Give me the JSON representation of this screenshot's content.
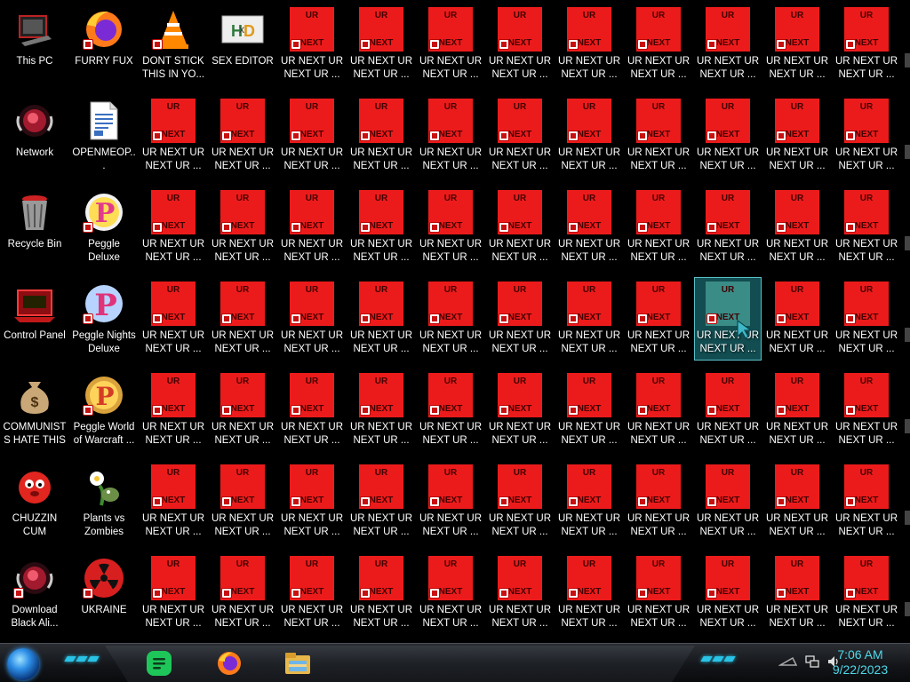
{
  "desktop": {
    "left_icons": [
      {
        "label": "This PC",
        "icon": "computer-icon"
      },
      {
        "label": "Network",
        "icon": "network-icon"
      },
      {
        "label": "Recycle Bin",
        "icon": "recycle-bin-icon"
      },
      {
        "label": "Control Panel",
        "icon": "control-panel-icon"
      },
      {
        "label": "COMMUNISTS HATE THIS G...",
        "icon": "money-bag-icon"
      },
      {
        "label": "CHUZZIN CUM",
        "icon": "chuzzle-icon"
      },
      {
        "label": "Download Black Ali...",
        "icon": "download-icon"
      }
    ],
    "second_column_icons": [
      {
        "label": "FURRY FUX",
        "icon": "firefox-icon"
      },
      {
        "label": "OPENMEOP...",
        "icon": "document-icon"
      },
      {
        "label": "Peggle Deluxe",
        "icon": "peggle-icon"
      },
      {
        "label": "Peggle Nights Deluxe",
        "icon": "peggle-nights-icon"
      },
      {
        "label": "Peggle World of Warcraft ...",
        "icon": "peggle-wow-icon"
      },
      {
        "label": "Plants vs Zombies",
        "icon": "pvz-icon"
      },
      {
        "label": "UKRAINE",
        "icon": "radiation-icon"
      }
    ],
    "row1_extra_icons": [
      {
        "label": "DONT STICK THIS IN YO...",
        "icon": "vlc-icon"
      },
      {
        "label": "SEX EDITOR",
        "icon": "hxd-icon"
      }
    ],
    "ur_tile": {
      "top_text": "UR",
      "bottom_text": "NEXT",
      "label": "UR NEXT UR NEXT UR ..."
    },
    "colors": {
      "ur_red": "#ec1b1b",
      "selection": "#28aab4"
    }
  },
  "taskbar": {
    "apps": [
      {
        "name": "spotify-icon"
      },
      {
        "name": "firefox-icon"
      },
      {
        "name": "file-explorer-icon"
      }
    ],
    "tray": [
      "show-hidden-icons-chevron",
      "network-icon",
      "volume-icon"
    ],
    "time": "7:06 AM",
    "date": "9/22/2023"
  }
}
